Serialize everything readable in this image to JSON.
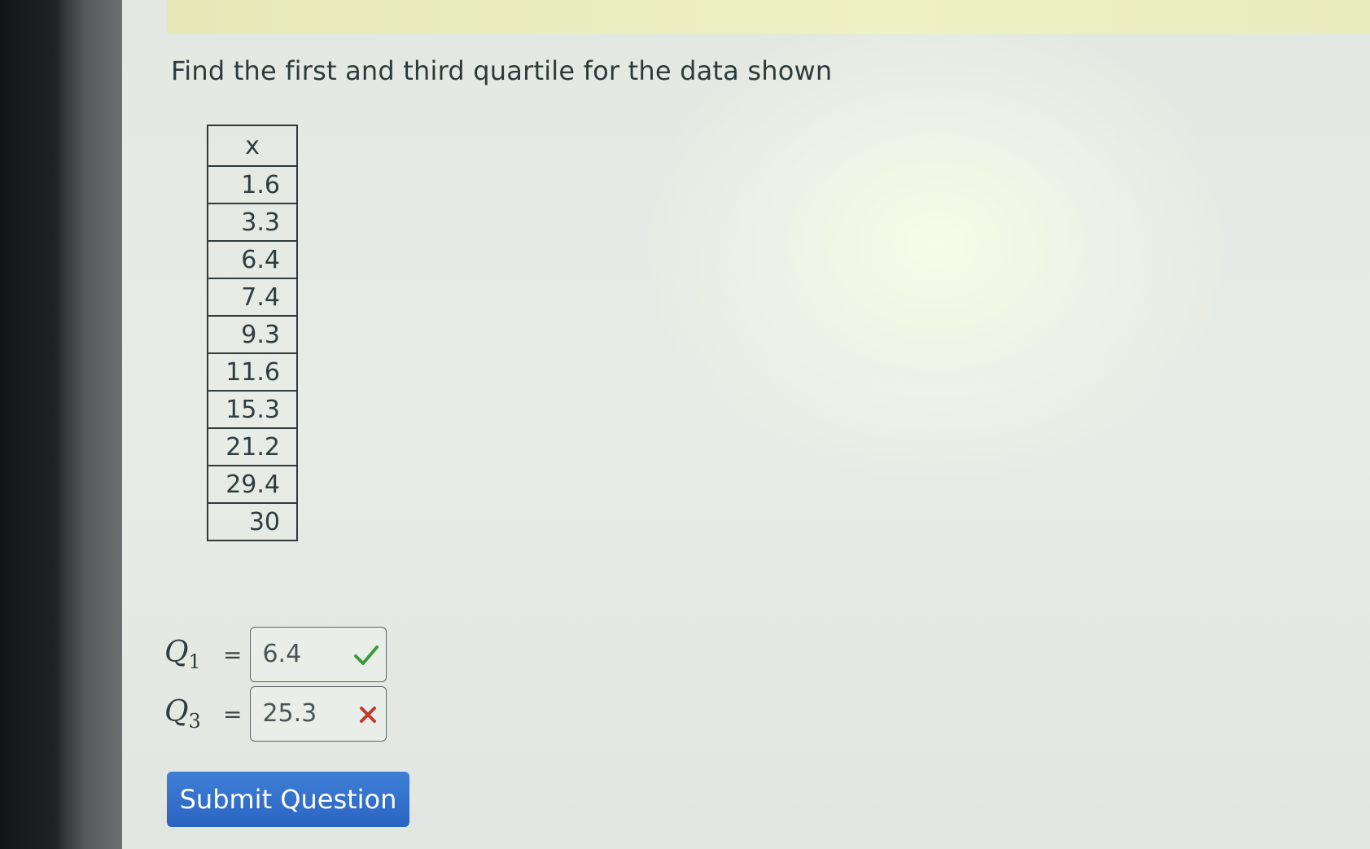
{
  "question": {
    "text": "Find the first and third quartile for the data shown"
  },
  "data_table": {
    "header": "x",
    "values": [
      "1.6",
      "3.3",
      "6.4",
      "7.4",
      "9.3",
      "11.6",
      "15.3",
      "21.2",
      "29.4",
      "30"
    ]
  },
  "answers": {
    "q1": {
      "label": "Q",
      "subscript": "1",
      "equals": "=",
      "value": "6.4",
      "status": "correct"
    },
    "q3": {
      "label": "Q",
      "subscript": "3",
      "equals": "=",
      "value": "25.3",
      "status": "incorrect"
    }
  },
  "submit_button": {
    "label": "Submit Question"
  },
  "colors": {
    "correct": "#3a9a3a",
    "incorrect": "#c23a2e",
    "button": "#2f6bc9"
  }
}
